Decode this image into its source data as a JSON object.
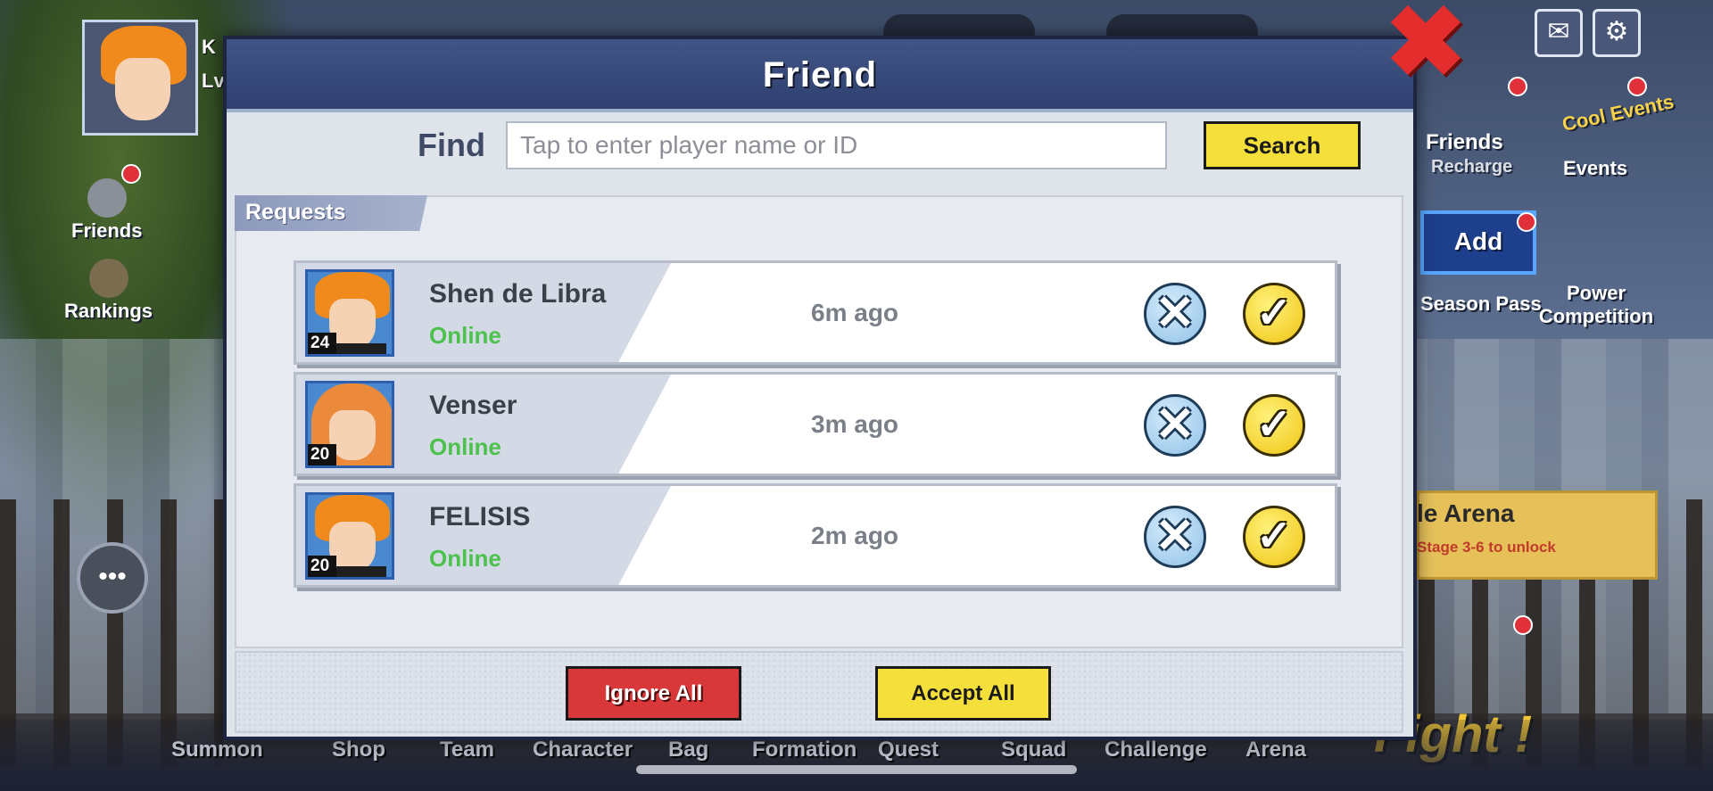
{
  "profile": {
    "name_fragment": "K",
    "level_fragment": "Lv"
  },
  "sidebar_left": [
    {
      "label": "Friends"
    },
    {
      "label": "Rankings"
    }
  ],
  "sidebar_right": {
    "friends_recharge": "Friends",
    "friends_recharge_sub": "Recharge",
    "events_logo": "Cool Events",
    "events": "Events",
    "add": "Add",
    "season_pass": "Season Pass",
    "power_competition": "Power Competition",
    "arena_title": "le Arena",
    "arena_sub": "Stage 3-6 to unlock",
    "fight": "Fight !"
  },
  "bottom_nav": [
    "Summon",
    "Shop",
    "Team",
    "Character",
    "Bag",
    "Formation",
    "Quest",
    "Squad",
    "Challenge",
    "Arena"
  ],
  "dialog": {
    "title": "Friend",
    "find_label": "Find",
    "search_placeholder": "Tap to enter player name or ID",
    "search_button": "Search",
    "requests_tab": "Requests",
    "ignore_all": "Ignore All",
    "accept_all": "Accept All"
  },
  "requests": [
    {
      "name": "Shen de Libra",
      "status": "Online",
      "time": "6m ago",
      "level": "24",
      "avatar": "orange-hair-male"
    },
    {
      "name": "Venser",
      "status": "Online",
      "time": "3m ago",
      "level": "20",
      "avatar": "orange-hair-female"
    },
    {
      "name": "FELISIS",
      "status": "Online",
      "time": "2m ago",
      "level": "20",
      "avatar": "orange-hair-male"
    }
  ],
  "colors": {
    "accept": "#f4df3b",
    "ignore": "#d9383a",
    "online": "#4cc24c",
    "header": "#2f4070"
  }
}
